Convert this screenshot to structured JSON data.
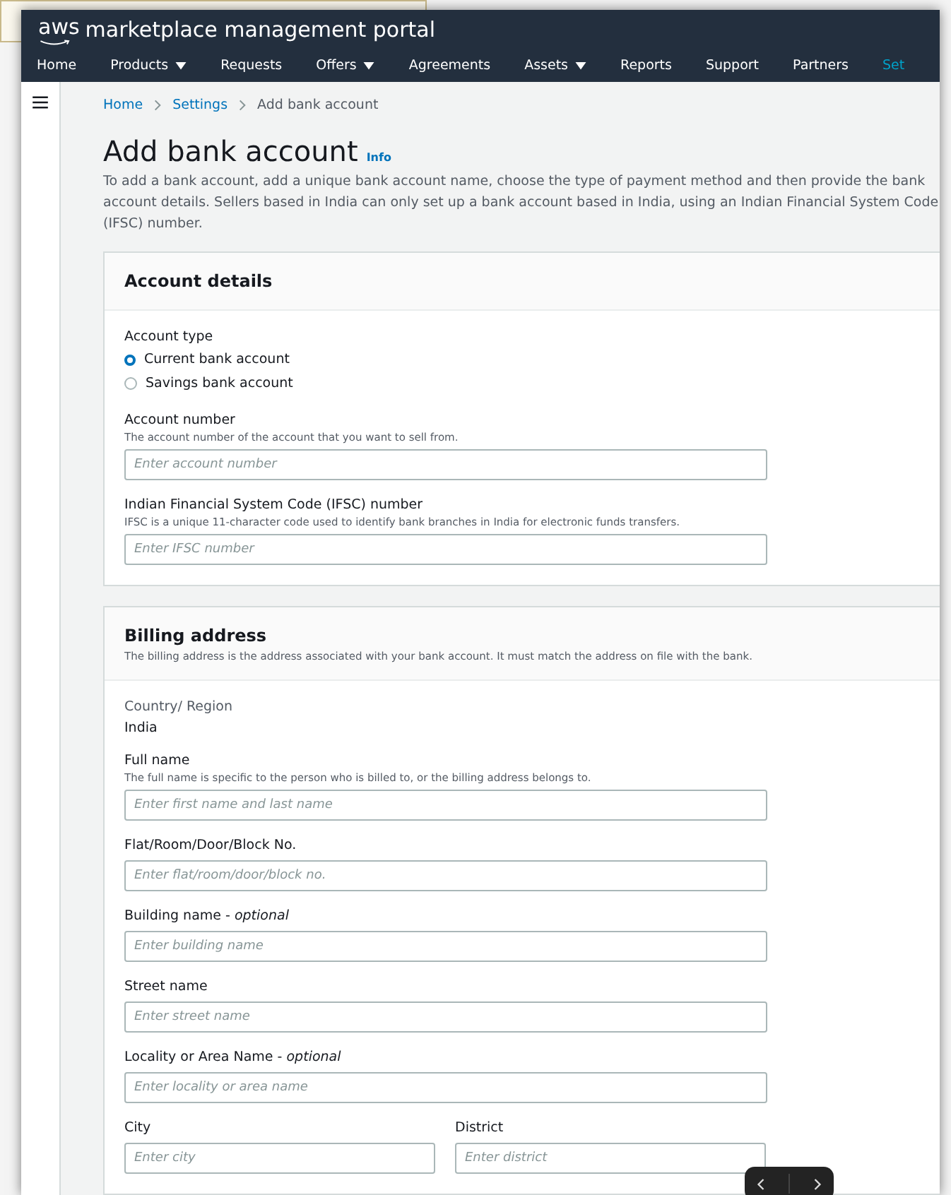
{
  "header": {
    "logo": "aws",
    "title": "marketplace management portal"
  },
  "nav": [
    {
      "label": "Home",
      "menu": false,
      "selected": false
    },
    {
      "label": "Products",
      "menu": true,
      "selected": false
    },
    {
      "label": "Requests",
      "menu": false,
      "selected": false
    },
    {
      "label": "Offers",
      "menu": true,
      "selected": false
    },
    {
      "label": "Agreements",
      "menu": false,
      "selected": false
    },
    {
      "label": "Assets",
      "menu": true,
      "selected": false
    },
    {
      "label": "Reports",
      "menu": false,
      "selected": false
    },
    {
      "label": "Support",
      "menu": false,
      "selected": false
    },
    {
      "label": "Partners",
      "menu": false,
      "selected": false
    },
    {
      "label": "Set",
      "menu": false,
      "selected": true
    }
  ],
  "breadcrumb": [
    {
      "label": "Home",
      "link": true
    },
    {
      "label": "Settings",
      "link": true
    },
    {
      "label": "Add bank account",
      "link": false
    }
  ],
  "page": {
    "title": "Add bank account",
    "info": "Info",
    "description": "To add a bank account, add a unique bank account name, choose the type of payment method and then provide the bank account details. Sellers based in India can only set up a bank account based in India, using an Indian Financial System Code (IFSC) number."
  },
  "sections": [
    {
      "title": "Account details",
      "fields": [
        {
          "kind": "radio",
          "label": "Account type",
          "options": [
            {
              "label": "Current bank account",
              "selected": true
            },
            {
              "label": "Savings bank account",
              "selected": false
            }
          ]
        },
        {
          "kind": "input",
          "label": "Account number",
          "description": "The account number of the account that you want to sell from.",
          "placeholder": "Enter account number"
        },
        {
          "kind": "input",
          "label": "Indian Financial System Code (IFSC) number",
          "description": "IFSC is a unique 11-character code used to identify bank branches in India for electronic funds transfers.",
          "placeholder": "Enter IFSC number"
        }
      ]
    },
    {
      "title": "Billing address",
      "description": "The billing address is the address associated with your bank account. It must match the address on file with the bank.",
      "fields": [
        {
          "kind": "static",
          "label": "Country/ Region",
          "value": "India"
        },
        {
          "kind": "input",
          "label": "Full name",
          "description": "The full name is specific to the person who is billed to, or the billing address belongs to.",
          "placeholder": "Enter first name and last name"
        },
        {
          "kind": "input",
          "label": "Flat/Room/Door/Block No.",
          "placeholder": "Enter flat/room/door/block no."
        },
        {
          "kind": "input",
          "label": "Building name - *optional*",
          "placeholder": "Enter building name"
        },
        {
          "kind": "input",
          "label": "Street name",
          "placeholder": "Enter street name"
        },
        {
          "kind": "input",
          "label": "Locality or Area Name - *optional*",
          "placeholder": "Enter locality or area name"
        },
        {
          "kind": "row",
          "fields": [
            {
              "label": "City",
              "placeholder": "Enter city"
            },
            {
              "label": "District",
              "placeholder": "Enter district"
            }
          ]
        }
      ]
    }
  ]
}
